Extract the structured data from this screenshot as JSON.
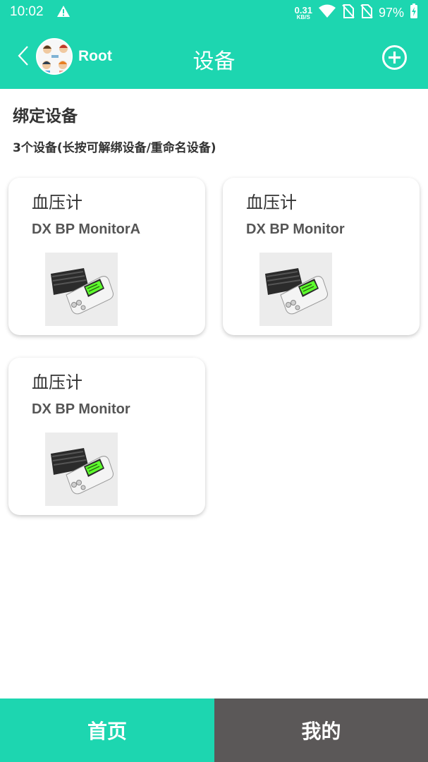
{
  "status_bar": {
    "time": "10:02",
    "net_speed": "0.31",
    "net_unit": "KB/S",
    "battery": "97%"
  },
  "header": {
    "username": "Root",
    "title": "设备",
    "bg_color": "#1dd6b0"
  },
  "section": {
    "title": "绑定设备",
    "subtitle": "3个设备(长按可解绑设备/重命名设备)"
  },
  "devices": [
    {
      "type": "血压计",
      "name": "DX BP MonitorA"
    },
    {
      "type": "血压计",
      "name": "DX BP Monitor"
    },
    {
      "type": "血压计",
      "name": "DX BP Monitor"
    }
  ],
  "tabs": {
    "home": "首页",
    "mine": "我的",
    "active_color": "#1dd6b0",
    "inactive_color": "#5b5858"
  },
  "icons": [
    "warning-icon",
    "wifi-icon",
    "no-sim-icon",
    "battery-icon",
    "back-icon",
    "add-circle-icon",
    "blood-pressure-monitor-image"
  ]
}
